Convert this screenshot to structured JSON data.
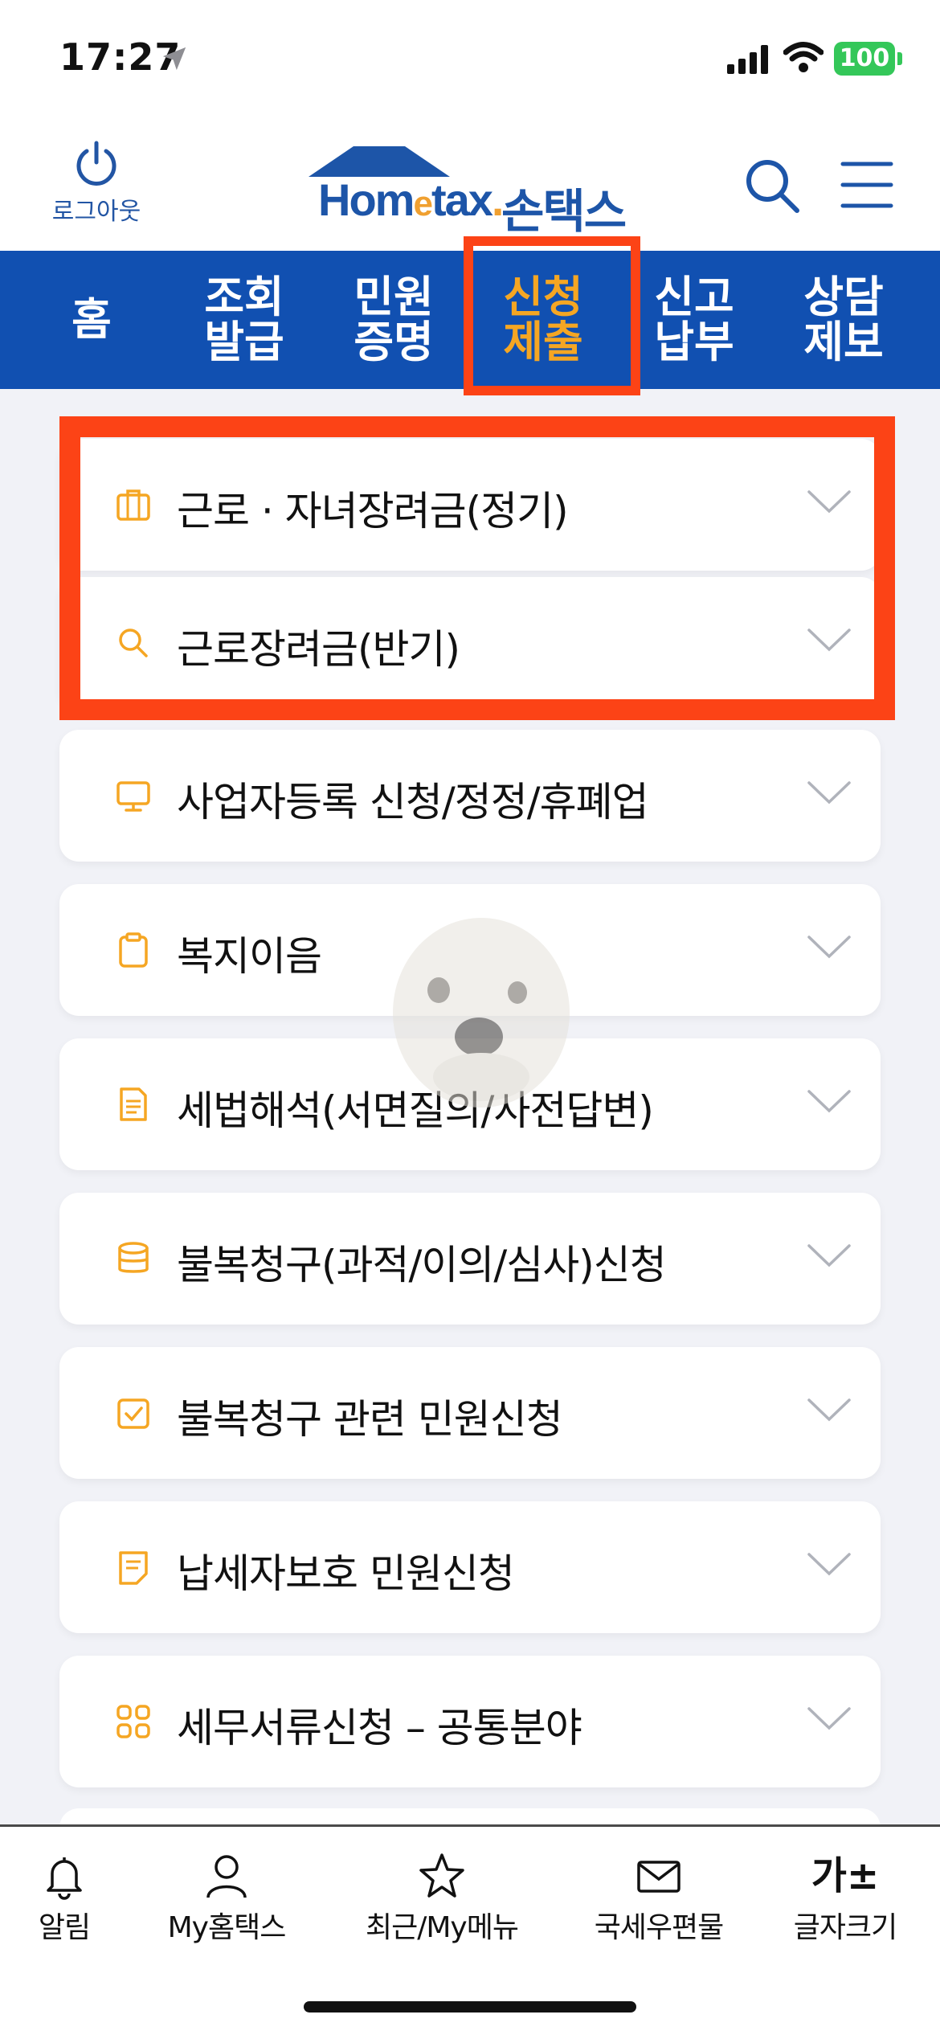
{
  "status_bar": {
    "time": "17:27",
    "battery": "100"
  },
  "header": {
    "logout_label": "로그아웃",
    "logo_text_pre": "Hom",
    "logo_text_e": "e",
    "logo_text_post": "tax",
    "logo_kr": "손택스"
  },
  "nav": {
    "items": [
      {
        "label": "홈"
      },
      {
        "label": "조회\n발급"
      },
      {
        "label": "민원\n증명"
      },
      {
        "label": "신청\n제출"
      },
      {
        "label": "신고\n납부"
      },
      {
        "label": "상담\n제보"
      }
    ],
    "active_index": 3
  },
  "menu": {
    "items": [
      {
        "label": "근로 · 자녀장려금(정기)",
        "icon": "briefcase-icon"
      },
      {
        "label": "근로장려금(반기)",
        "icon": "search-icon"
      },
      {
        "label": "사업자등록 신청/정정/휴폐업",
        "icon": "monitor-icon"
      },
      {
        "label": "복지이음",
        "icon": "clipboard-icon"
      },
      {
        "label": "세법해석(서면질의/사전답변)",
        "icon": "document-icon"
      },
      {
        "label": "불복청구(과적/이의/심사)신청",
        "icon": "database-icon"
      },
      {
        "label": "불복청구 관련 민원신청",
        "icon": "checkbox-icon"
      },
      {
        "label": "납세자보호 민원신청",
        "icon": "note-icon"
      },
      {
        "label": "세무서류신청 – 공통분야",
        "icon": "grid-icon"
      }
    ]
  },
  "tabbar": {
    "items": [
      {
        "label": "알림",
        "icon": "bell-icon"
      },
      {
        "label": "My홈택스",
        "icon": "person-icon"
      },
      {
        "label": "최근/My메뉴",
        "icon": "star-icon"
      },
      {
        "label": "국세우편물",
        "icon": "mail-icon"
      },
      {
        "label": "글자크기",
        "icon": "font-size-icon",
        "glyph": "가±"
      }
    ]
  },
  "colors": {
    "brand_blue": "#1150b1",
    "accent_orange": "#f5a623",
    "highlight_red": "#fc4316"
  }
}
